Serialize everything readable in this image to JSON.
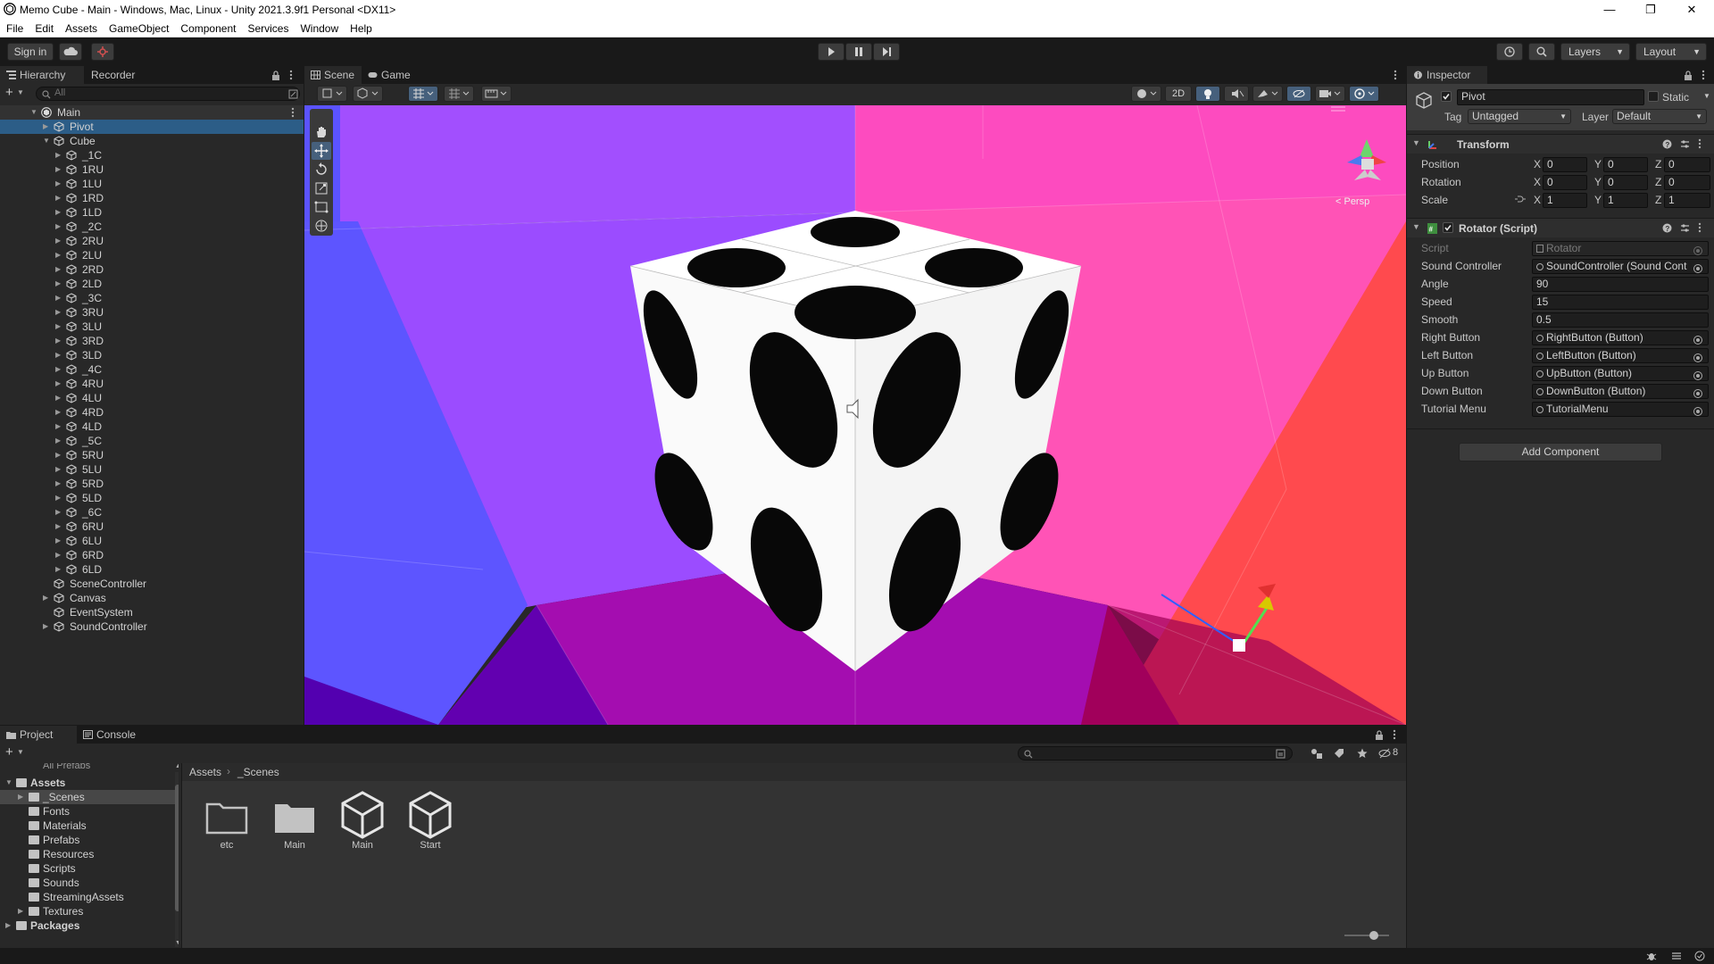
{
  "window": {
    "title": "Memo Cube - Main - Windows, Mac, Linux - Unity 2021.3.9f1 Personal <DX11>",
    "minimize": "—",
    "maximize": "❐",
    "close": "✕"
  },
  "menu": [
    "File",
    "Edit",
    "Assets",
    "GameObject",
    "Component",
    "Services",
    "Window",
    "Help"
  ],
  "toolbar": {
    "sign_in": "Sign in",
    "layers": "Layers",
    "layout": "Layout"
  },
  "hierarchy": {
    "tab": "Hierarchy",
    "recorder_tab": "Recorder",
    "search_placeholder": "All",
    "scene": "Main",
    "rows": [
      {
        "label": "Pivot",
        "depth": 1,
        "fold": true,
        "selected": true
      },
      {
        "label": "Cube",
        "depth": 1,
        "fold": true,
        "open": true
      },
      {
        "label": "_1C",
        "depth": 2,
        "fold": true
      },
      {
        "label": "1RU",
        "depth": 2,
        "fold": true
      },
      {
        "label": "1LU",
        "depth": 2,
        "fold": true
      },
      {
        "label": "1RD",
        "depth": 2,
        "fold": true
      },
      {
        "label": "1LD",
        "depth": 2,
        "fold": true
      },
      {
        "label": "_2C",
        "depth": 2,
        "fold": true
      },
      {
        "label": "2RU",
        "depth": 2,
        "fold": true
      },
      {
        "label": "2LU",
        "depth": 2,
        "fold": true
      },
      {
        "label": "2RD",
        "depth": 2,
        "fold": true
      },
      {
        "label": "2LD",
        "depth": 2,
        "fold": true
      },
      {
        "label": "_3C",
        "depth": 2,
        "fold": true
      },
      {
        "label": "3RU",
        "depth": 2,
        "fold": true
      },
      {
        "label": "3LU",
        "depth": 2,
        "fold": true
      },
      {
        "label": "3RD",
        "depth": 2,
        "fold": true
      },
      {
        "label": "3LD",
        "depth": 2,
        "fold": true
      },
      {
        "label": "_4C",
        "depth": 2,
        "fold": true
      },
      {
        "label": "4RU",
        "depth": 2,
        "fold": true
      },
      {
        "label": "4LU",
        "depth": 2,
        "fold": true
      },
      {
        "label": "4RD",
        "depth": 2,
        "fold": true
      },
      {
        "label": "4LD",
        "depth": 2,
        "fold": true
      },
      {
        "label": "_5C",
        "depth": 2,
        "fold": true
      },
      {
        "label": "5RU",
        "depth": 2,
        "fold": true
      },
      {
        "label": "5LU",
        "depth": 2,
        "fold": true
      },
      {
        "label": "5RD",
        "depth": 2,
        "fold": true
      },
      {
        "label": "5LD",
        "depth": 2,
        "fold": true
      },
      {
        "label": "_6C",
        "depth": 2,
        "fold": true
      },
      {
        "label": "6RU",
        "depth": 2,
        "fold": true
      },
      {
        "label": "6LU",
        "depth": 2,
        "fold": true
      },
      {
        "label": "6RD",
        "depth": 2,
        "fold": true
      },
      {
        "label": "6LD",
        "depth": 2,
        "fold": true
      },
      {
        "label": "SceneController",
        "depth": 1,
        "fold": false
      },
      {
        "label": "Canvas",
        "depth": 1,
        "fold": true
      },
      {
        "label": "EventSystem",
        "depth": 1,
        "fold": false
      },
      {
        "label": "SoundController",
        "depth": 1,
        "fold": true
      }
    ]
  },
  "scene_view": {
    "scene_tab": "Scene",
    "game_tab": "Game",
    "mode_2d": "2D",
    "persp": "< Persp"
  },
  "inspector": {
    "tab": "Inspector",
    "object_name": "Pivot",
    "static_label": "Static",
    "tag_label": "Tag",
    "tag_value": "Untagged",
    "layer_label": "Layer",
    "layer_value": "Default",
    "transform": {
      "title": "Transform",
      "position": {
        "label": "Position",
        "x": "0",
        "y": "0",
        "z": "0"
      },
      "rotation": {
        "label": "Rotation",
        "x": "0",
        "y": "0",
        "z": "0"
      },
      "scale": {
        "label": "Scale",
        "x": "1",
        "y": "1",
        "z": "1"
      }
    },
    "axis": {
      "x": "X",
      "y": "Y",
      "z": "Z"
    },
    "rotator": {
      "title": "Rotator (Script)",
      "script_label": "Script",
      "script_value": "Rotator",
      "fields": [
        {
          "label": "Sound Controller",
          "value": "SoundController (Sound Cont",
          "ref": true
        },
        {
          "label": "Angle",
          "value": "90",
          "ref": false
        },
        {
          "label": "Speed",
          "value": "15",
          "ref": false
        },
        {
          "label": "Smooth",
          "value": "0.5",
          "ref": false
        },
        {
          "label": "Right Button",
          "value": "RightButton (Button)",
          "ref": true
        },
        {
          "label": "Left Button",
          "value": "LeftButton (Button)",
          "ref": true
        },
        {
          "label": "Up Button",
          "value": "UpButton (Button)",
          "ref": true
        },
        {
          "label": "Down Button",
          "value": "DownButton (Button)",
          "ref": true
        },
        {
          "label": "Tutorial Menu",
          "value": "TutorialMenu",
          "ref": true
        }
      ]
    },
    "add_component": "Add Component"
  },
  "project": {
    "tab": "Project",
    "console_tab": "Console",
    "all_prefabs": "All Prefabs",
    "hidden_count": "8",
    "tree": [
      {
        "label": "Assets",
        "depth": 0,
        "bold": true,
        "open": true
      },
      {
        "label": "_Scenes",
        "depth": 1,
        "selected": true,
        "fold": true
      },
      {
        "label": "Fonts",
        "depth": 1
      },
      {
        "label": "Materials",
        "depth": 1
      },
      {
        "label": "Prefabs",
        "depth": 1
      },
      {
        "label": "Resources",
        "depth": 1
      },
      {
        "label": "Scripts",
        "depth": 1
      },
      {
        "label": "Sounds",
        "depth": 1
      },
      {
        "label": "StreamingAssets",
        "depth": 1
      },
      {
        "label": "Textures",
        "depth": 1,
        "fold": true
      },
      {
        "label": "Packages",
        "depth": 0,
        "bold": true,
        "fold": true
      }
    ],
    "breadcrumb": [
      "Assets",
      "_Scenes"
    ],
    "breadcrumb_sep": "›",
    "assets": [
      {
        "label": "etc",
        "kind": "folder-empty"
      },
      {
        "label": "Main",
        "kind": "folder"
      },
      {
        "label": "Main",
        "kind": "scene"
      },
      {
        "label": "Start",
        "kind": "scene"
      }
    ]
  }
}
